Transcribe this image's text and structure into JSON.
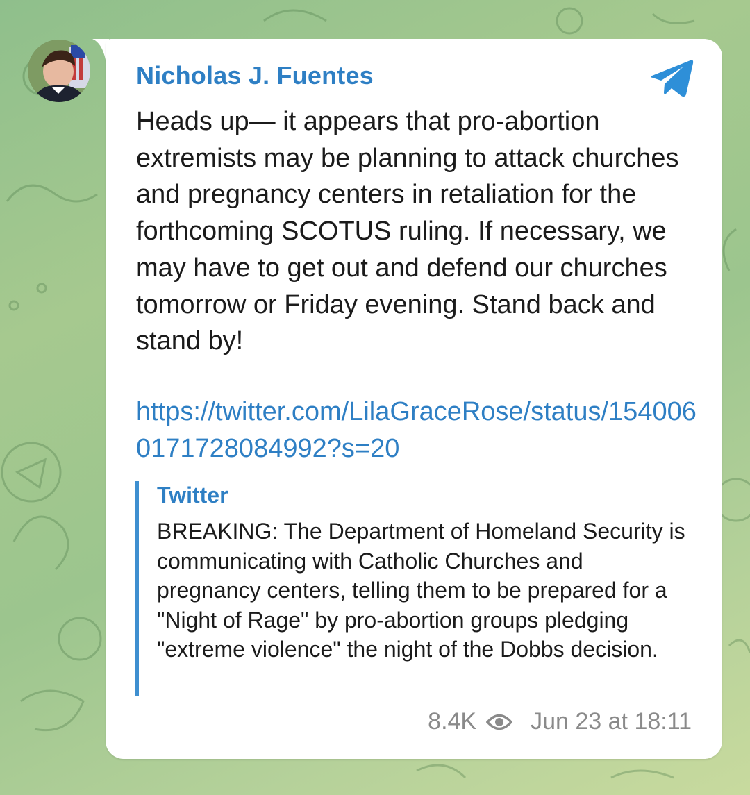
{
  "post": {
    "sender": "Nicholas J. Fuentes",
    "text": "Heads up— it appears that pro-abortion extremists may be planning to attack churches and pregnancy centers in retaliation for the forthcoming SCOTUS ruling. If necessary, we may have to get out and defend our churches tomorrow or Friday evening. Stand back and stand by!",
    "link": "https://twitter.com/LilaGraceRose/status/1540060171728084992?s=20",
    "views": "8.4K",
    "time": "Jun 23 at 18:11"
  },
  "preview": {
    "site": "Twitter",
    "text": "BREAKING: The Department of Homeland Security is communicating with Catholic Churches and pregnancy centers, telling them to be prepared for a \"Night of Rage\" by pro-abortion groups pledging \"extreme violence\" the night of the Dobbs decision."
  },
  "icons": {
    "channel": "telegram-icon",
    "views": "eye-icon",
    "avatar": "avatar"
  },
  "colors": {
    "accent": "#2e7fc4",
    "preview_bar": "#3e8fd0",
    "text": "#1b1b1b",
    "meta": "#8a8a8a",
    "bubble": "#ffffff"
  }
}
